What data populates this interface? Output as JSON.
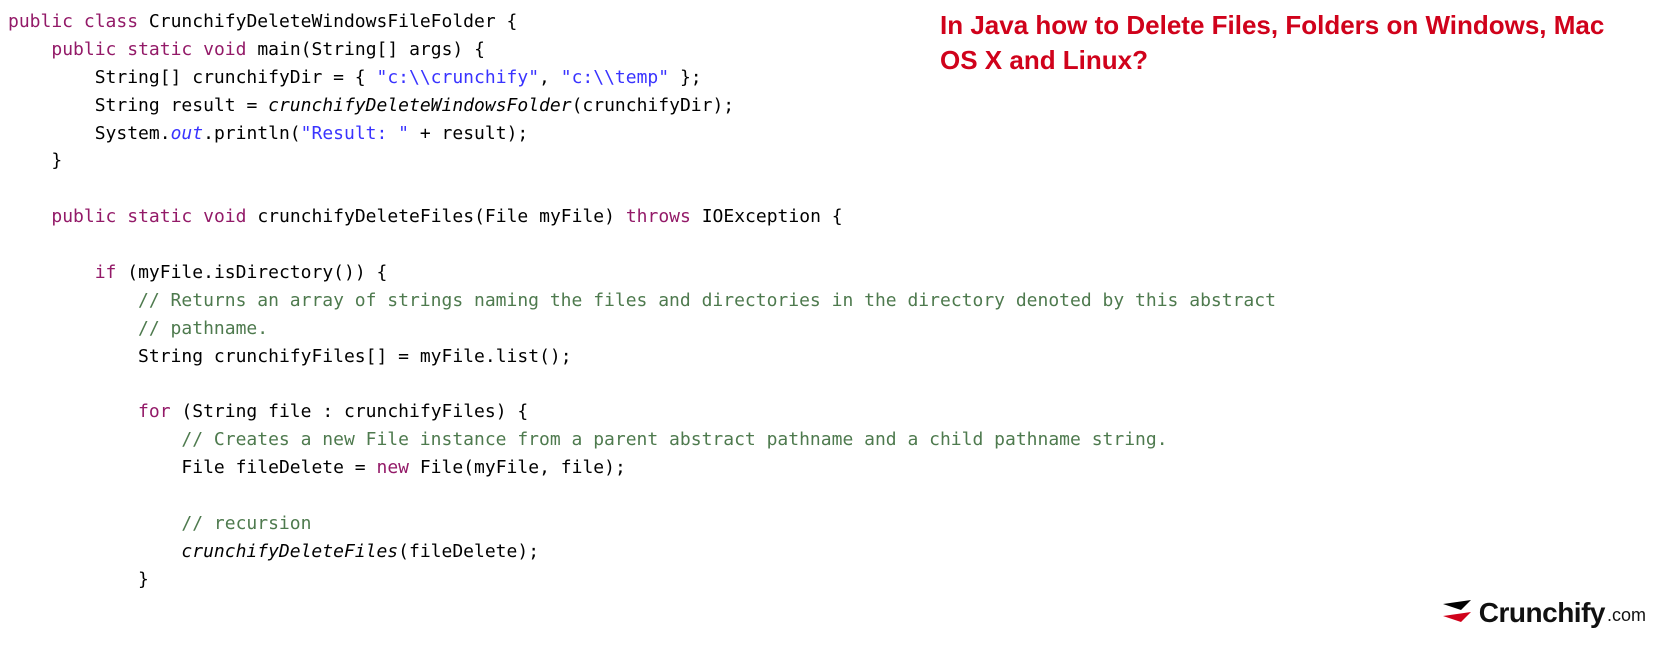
{
  "headline": "In Java how to Delete Files, Folders on Windows, Mac OS X and Linux?",
  "logo": {
    "brand": "Crunchify",
    "suffix": ".com"
  },
  "code": {
    "kw": {
      "public": "public",
      "class": "class",
      "static": "static",
      "void": "void",
      "if": "if",
      "for": "for",
      "throws": "throws",
      "new": "new"
    },
    "className": "CrunchifyDeleteWindowsFileFolder",
    "mainSig": {
      "name": "main",
      "paramType": "String[]",
      "paramName": "args"
    },
    "line1": {
      "type": "String[]",
      "var": "crunchifyDir",
      "lit1": "\"c:\\\\crunchify\"",
      "lit2": "\"c:\\\\temp\""
    },
    "line2": {
      "type": "String",
      "var": "result",
      "call": "crunchifyDeleteWindowsFolder",
      "arg": "crunchifyDir"
    },
    "line3": {
      "sys": "System",
      "out": "out",
      "print": "println",
      "lit": "\"Result: \"",
      "var": "result"
    },
    "method2": {
      "name": "crunchifyDeleteFiles",
      "paramType": "File",
      "paramName": "myFile",
      "throwsType": "IOException"
    },
    "ifCond": {
      "obj": "myFile",
      "call": "isDirectory"
    },
    "comment1a": "// Returns an array of strings naming the files and directories in the directory denoted by this abstract",
    "comment1b": "// pathname.",
    "listLine": {
      "type": "String",
      "var": "crunchifyFiles",
      "obj": "myFile",
      "call": "list"
    },
    "forLine": {
      "type": "String",
      "var": "file",
      "iter": "crunchifyFiles"
    },
    "comment2": "// Creates a new File instance from a parent abstract pathname and a child pathname string.",
    "fileDeleteLine": {
      "type": "File",
      "var": "fileDelete",
      "ctorType": "File",
      "arg1": "myFile",
      "arg2": "file"
    },
    "comment3": "// recursion",
    "recurseLine": {
      "call": "crunchifyDeleteFiles",
      "arg": "fileDelete"
    }
  }
}
